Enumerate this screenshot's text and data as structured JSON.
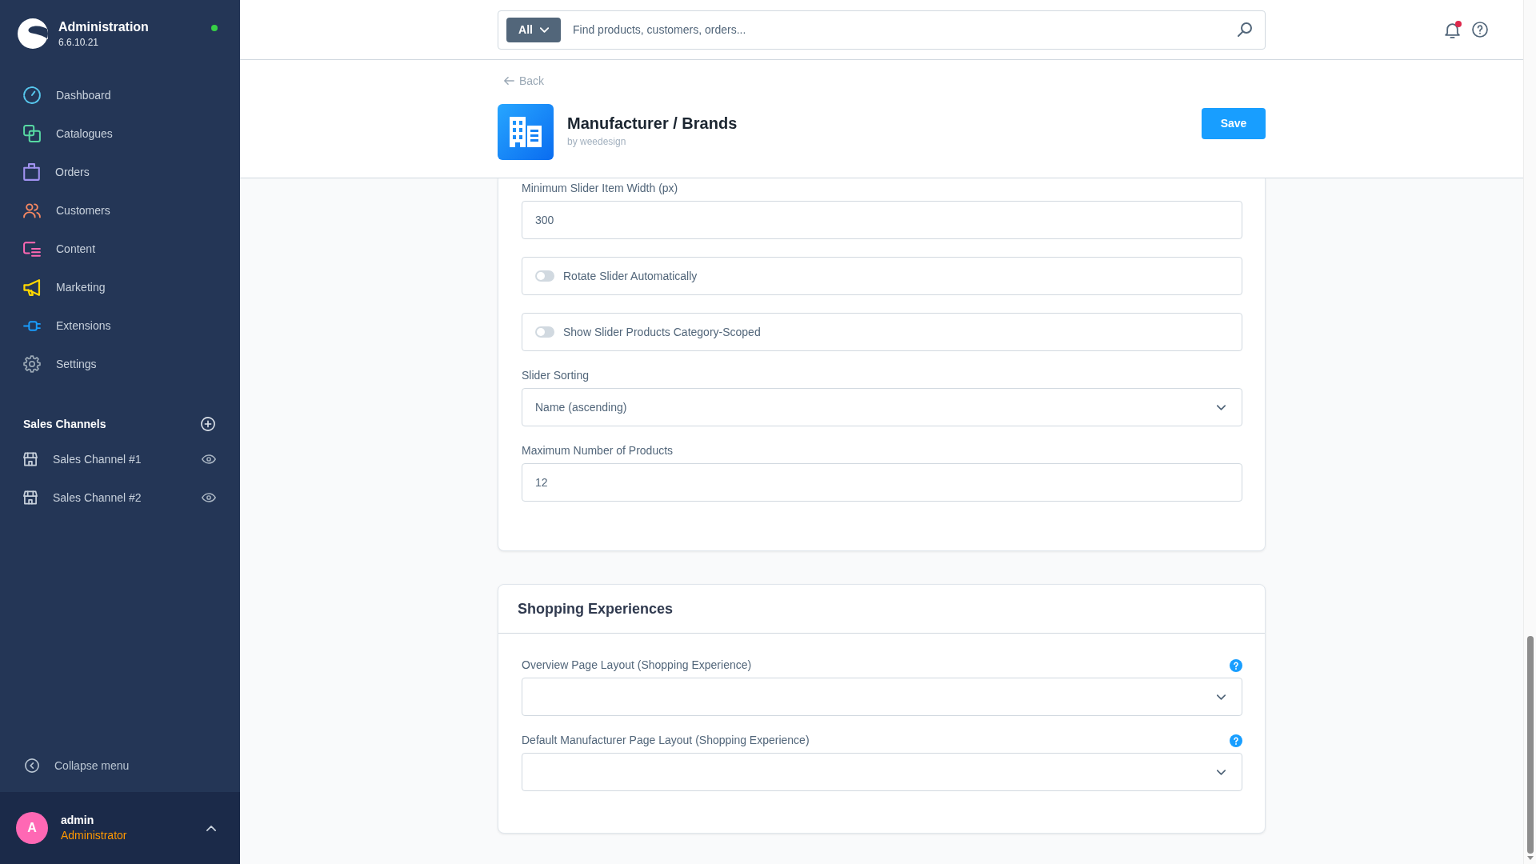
{
  "sidebar": {
    "brand": {
      "title": "Administration",
      "version": "6.6.10.21"
    },
    "nav": [
      {
        "label": "Dashboard",
        "color": "#57c7ed"
      },
      {
        "label": "Catalogues",
        "color": "#57d9a3"
      },
      {
        "label": "Orders",
        "color": "#a092f0"
      },
      {
        "label": "Customers",
        "color": "#f88962"
      },
      {
        "label": "Content",
        "color": "#ff68b4"
      },
      {
        "label": "Marketing",
        "color": "#ffd700"
      },
      {
        "label": "Extensions",
        "color": "#189eff"
      },
      {
        "label": "Settings",
        "color": "#9aa8b5"
      }
    ],
    "sales_channels": {
      "title": "Sales Channels",
      "items": [
        {
          "label": "Sales Channel #1"
        },
        {
          "label": "Sales Channel #2"
        }
      ]
    },
    "collapse_menu": "Collapse menu",
    "user": {
      "initial": "A",
      "name": "admin",
      "role": "Administrator"
    }
  },
  "topbar": {
    "search": {
      "scope": "All",
      "placeholder": "Find products, customers, orders..."
    },
    "notifications": {
      "unread": true
    }
  },
  "page_header": {
    "back": "Back",
    "title": "Manufacturer / Brands",
    "subtitle": "by weedesign",
    "save": "Save"
  },
  "cards": [
    {
      "fields": [
        {
          "kind": "text",
          "label": "Minimum Slider Item Width (px)",
          "value": "300"
        },
        {
          "kind": "switch",
          "label": "Rotate Slider Automatically",
          "on": false
        },
        {
          "kind": "switch",
          "label": "Show Slider Products Category-Scoped",
          "on": false
        },
        {
          "kind": "select",
          "label": "Slider Sorting",
          "value": "Name (ascending)"
        },
        {
          "kind": "text",
          "label": "Maximum Number of Products",
          "value": "12"
        }
      ]
    },
    {
      "title": "Shopping Experiences",
      "fields": [
        {
          "kind": "select",
          "label": "Overview Page Layout (Shopping Experience)",
          "help": true
        },
        {
          "kind": "select",
          "label": "Default Manufacturer Page Layout (Shopping Experience)",
          "help": true
        }
      ]
    }
  ]
}
